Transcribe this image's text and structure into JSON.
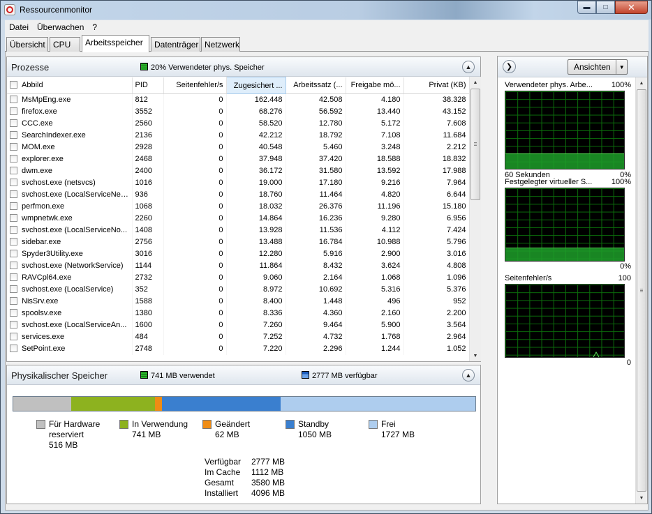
{
  "window": {
    "title": "Ressourcenmonitor"
  },
  "menu": [
    "Datei",
    "Überwachen",
    "?"
  ],
  "tabs": [
    "Übersicht",
    "CPU",
    "Arbeitsspeicher",
    "Datenträger",
    "Netzwerk"
  ],
  "active_tab": "Arbeitsspeicher",
  "processes": {
    "title": "Prozesse",
    "summary": "20% Verwendeter phys. Speicher",
    "columns": [
      "Abbild",
      "PID",
      "Seitenfehler/s",
      "Zugesichert ...",
      "Arbeitssatz (...",
      "Freigabe mö...",
      "Privat (KB)"
    ],
    "sorted_column": "Zugesichert ...",
    "rows": [
      [
        "MsMpEng.exe",
        "812",
        "0",
        "162.448",
        "42.508",
        "4.180",
        "38.328"
      ],
      [
        "firefox.exe",
        "3552",
        "0",
        "68.276",
        "56.592",
        "13.440",
        "43.152"
      ],
      [
        "CCC.exe",
        "2560",
        "0",
        "58.520",
        "12.780",
        "5.172",
        "7.608"
      ],
      [
        "SearchIndexer.exe",
        "2136",
        "0",
        "42.212",
        "18.792",
        "7.108",
        "11.684"
      ],
      [
        "MOM.exe",
        "2928",
        "0",
        "40.548",
        "5.460",
        "3.248",
        "2.212"
      ],
      [
        "explorer.exe",
        "2468",
        "0",
        "37.948",
        "37.420",
        "18.588",
        "18.832"
      ],
      [
        "dwm.exe",
        "2400",
        "0",
        "36.172",
        "31.580",
        "13.592",
        "17.988"
      ],
      [
        "svchost.exe (netsvcs)",
        "1016",
        "0",
        "19.000",
        "17.180",
        "9.216",
        "7.964"
      ],
      [
        "svchost.exe (LocalServiceNet...",
        "936",
        "0",
        "18.760",
        "11.464",
        "4.820",
        "6.644"
      ],
      [
        "perfmon.exe",
        "1068",
        "0",
        "18.032",
        "26.376",
        "11.196",
        "15.180"
      ],
      [
        "wmpnetwk.exe",
        "2260",
        "0",
        "14.864",
        "16.236",
        "9.280",
        "6.956"
      ],
      [
        "svchost.exe (LocalServiceNo...",
        "1408",
        "0",
        "13.928",
        "11.536",
        "4.112",
        "7.424"
      ],
      [
        "sidebar.exe",
        "2756",
        "0",
        "13.488",
        "16.784",
        "10.988",
        "5.796"
      ],
      [
        "Spyder3Utility.exe",
        "3016",
        "0",
        "12.280",
        "5.916",
        "2.900",
        "3.016"
      ],
      [
        "svchost.exe (NetworkService)",
        "1144",
        "0",
        "11.864",
        "8.432",
        "3.624",
        "4.808"
      ],
      [
        "RAVCpl64.exe",
        "2732",
        "0",
        "9.060",
        "2.164",
        "1.068",
        "1.096"
      ],
      [
        "svchost.exe (LocalService)",
        "352",
        "0",
        "8.972",
        "10.692",
        "5.316",
        "5.376"
      ],
      [
        "NisSrv.exe",
        "1588",
        "0",
        "8.400",
        "1.448",
        "496",
        "952"
      ],
      [
        "spoolsv.exe",
        "1380",
        "0",
        "8.336",
        "4.360",
        "2.160",
        "2.200"
      ],
      [
        "svchost.exe (LocalServiceAn...",
        "1600",
        "0",
        "7.260",
        "9.464",
        "5.900",
        "3.564"
      ],
      [
        "services.exe",
        "484",
        "0",
        "7.252",
        "4.732",
        "1.768",
        "2.964"
      ],
      [
        "SetPoint.exe",
        "2748",
        "0",
        "7.220",
        "2.296",
        "1.244",
        "1.052"
      ]
    ]
  },
  "physical": {
    "title": "Physikalischer Speicher",
    "used": "741 MB verwendet",
    "available": "2777 MB verfügbar",
    "bar": [
      {
        "key": "hardware",
        "mb": 516,
        "color": "#c0c0c0"
      },
      {
        "key": "inuse",
        "mb": 741,
        "color": "#8db21f"
      },
      {
        "key": "modified",
        "mb": 62,
        "color": "#ef8c14"
      },
      {
        "key": "standby",
        "mb": 1050,
        "color": "#3a7fcf"
      },
      {
        "key": "free",
        "mb": 1727,
        "color": "#aecdee"
      }
    ],
    "legend": {
      "hardware": {
        "label1": "Für Hardware",
        "label2": "reserviert",
        "value": "516 MB"
      },
      "inuse": {
        "label1": "In Verwendung",
        "value": "741 MB"
      },
      "modified": {
        "label1": "Geändert",
        "value": "62 MB"
      },
      "standby": {
        "label1": "Standby",
        "value": "1050 MB"
      },
      "free": {
        "label1": "Frei",
        "value": "1727 MB"
      }
    },
    "stats": [
      {
        "label": "Verfügbar",
        "value": "2777 MB"
      },
      {
        "label": "Im Cache",
        "value": "1112 MB"
      },
      {
        "label": "Gesamt",
        "value": "3580 MB"
      },
      {
        "label": "Installiert",
        "value": "4096 MB"
      }
    ]
  },
  "graphs": {
    "views_button": "Ansichten",
    "g1": {
      "title": "Verwendeter phys. Arbe...",
      "max": "100%",
      "footer_left": "60 Sekunden",
      "footer_right": "0%",
      "level": 0.2
    },
    "g2": {
      "title": "Festgelegter virtueller S...",
      "max": "100%",
      "footer_right": "0%",
      "level": 0.18
    },
    "g3": {
      "title": "Seitenfehler/s",
      "max": "100",
      "footer_right": "0",
      "level": 0.0
    }
  }
}
